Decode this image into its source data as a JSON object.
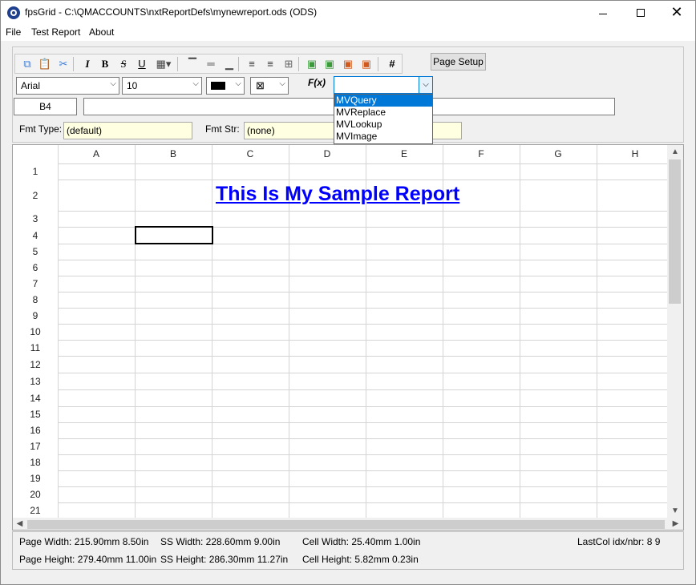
{
  "window": {
    "title": "fpsGrid - C:\\QMACCOUNTS\\nxtReportDefs\\mynewreport.ods (ODS)",
    "minimize_icon": "minimize-icon",
    "maximize_icon": "maximize-icon",
    "close_glyph": "✕"
  },
  "menu": [
    "File",
    "Test Report",
    "About"
  ],
  "toolbar": {
    "buttons": [
      {
        "icon": "copy-icon",
        "glyph": "⧉"
      },
      {
        "icon": "paste-icon",
        "glyph": "📋"
      },
      {
        "icon": "cut-icon",
        "glyph": "✂"
      },
      {
        "icon": "italic-icon",
        "glyph": "I"
      },
      {
        "icon": "bold-icon",
        "glyph": "B"
      },
      {
        "icon": "strikethrough-icon",
        "glyph": "S"
      },
      {
        "icon": "underline-icon",
        "glyph": "U"
      },
      {
        "icon": "border-icon",
        "glyph": "▦▾"
      },
      {
        "icon": "valign-top-icon",
        "glyph": "▔"
      },
      {
        "icon": "valign-middle-icon",
        "glyph": "═"
      },
      {
        "icon": "valign-bottom-icon",
        "glyph": "▁"
      },
      {
        "icon": "align-left-icon",
        "glyph": "≡"
      },
      {
        "icon": "align-center-icon",
        "glyph": "≡"
      },
      {
        "icon": "merge-icon",
        "glyph": "⊞"
      },
      {
        "icon": "insert-row-icon",
        "glyph": "▣"
      },
      {
        "icon": "insert-col-icon",
        "glyph": "▣"
      },
      {
        "icon": "delete-row-icon",
        "glyph": "▣"
      },
      {
        "icon": "delete-col-icon",
        "glyph": "▣"
      },
      {
        "icon": "number-format-icon",
        "glyph": "#"
      }
    ],
    "page_setup": "Page Setup"
  },
  "format": {
    "font": "Arial",
    "size": "10",
    "fx_label": "F(x)",
    "fx_value": "",
    "cell_ref": "B4",
    "formula": "",
    "fmt_type_label": "Fmt Type:",
    "fmt_type_value": "(default)",
    "fmt_str_label": "Fmt Str:",
    "fmt_str_value": "(none)"
  },
  "fx_options": [
    "MVQuery",
    "MVReplace",
    "MVLookup",
    "MVImage"
  ],
  "fx_selected": "MVQuery",
  "grid": {
    "columns": [
      "A",
      "B",
      "C",
      "D",
      "E",
      "F",
      "G",
      "H"
    ],
    "rows": [
      "1",
      "2",
      "3",
      "4",
      "5",
      "6",
      "7",
      "8",
      "9",
      "10",
      "11",
      "12",
      "13",
      "14",
      "15",
      "16",
      "17",
      "18",
      "19",
      "20",
      "21"
    ],
    "report_title": "This Is My Sample Report",
    "selected_cell": "B4"
  },
  "status": {
    "page_width": "Page Width: 215.90mm 8.50in",
    "page_height": "Page Height: 279.40mm 11.00in",
    "ss_width": "SS Width: 228.60mm 9.00in",
    "ss_height": "SS Height: 286.30mm 11.27in",
    "cell_width": "Cell Width: 25.40mm 1.00in",
    "cell_height": "Cell Height: 5.82mm 0.23in",
    "last_col": "LastCol idx/nbr: 8 9"
  }
}
